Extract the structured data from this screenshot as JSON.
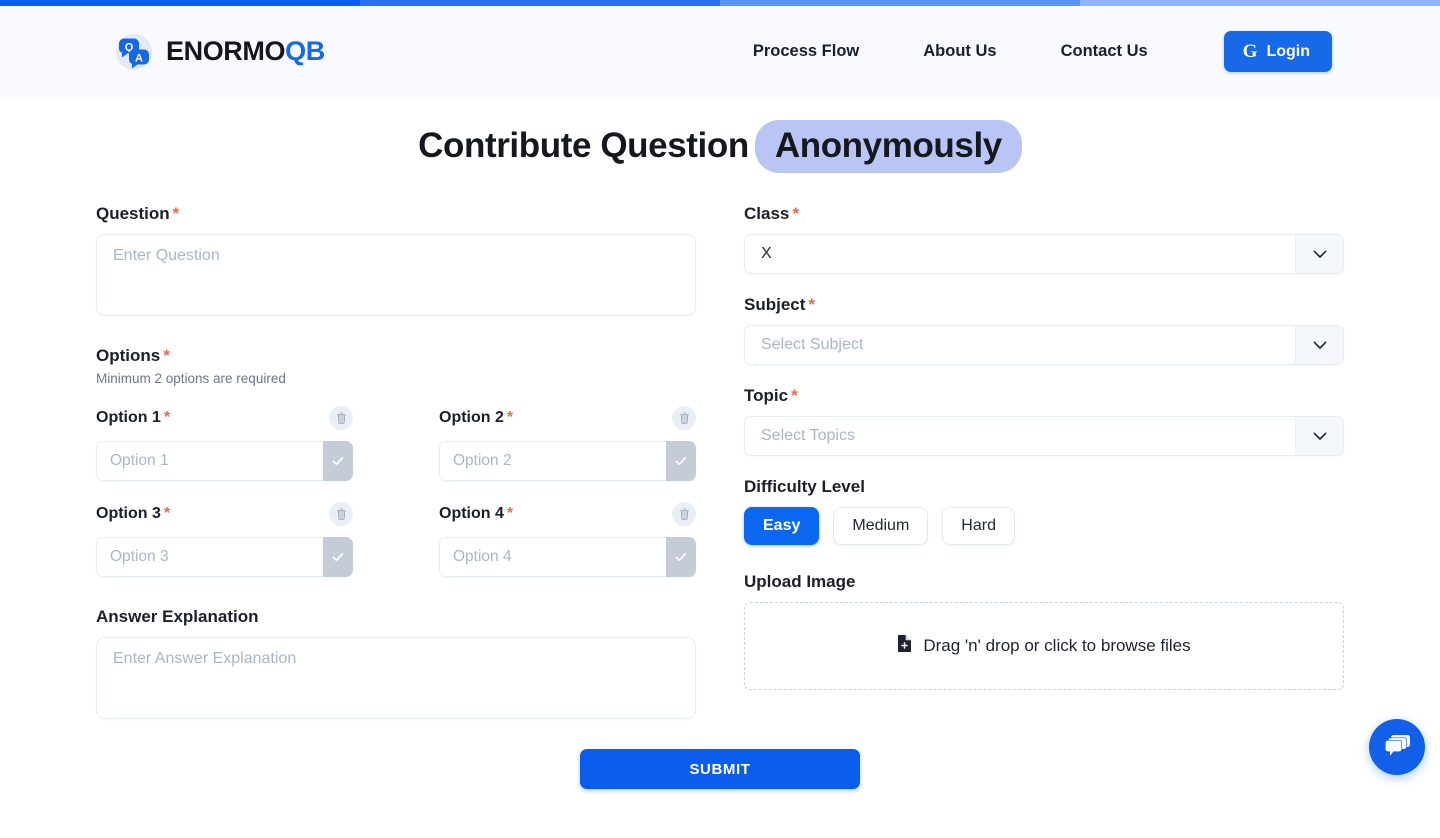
{
  "progress": {
    "segments": [
      "#0b5ded",
      "#2a72ef",
      "#5a93f2",
      "#8cb4f7"
    ]
  },
  "header": {
    "brand": {
      "name_primary": "ENORMO",
      "name_accent": "QB",
      "logo_icon": "qa-speech-bubbles-icon",
      "bubble_q": "Q",
      "bubble_a": "A"
    },
    "nav": [
      {
        "label": "Process Flow"
      },
      {
        "label": "About Us"
      },
      {
        "label": "Contact Us"
      }
    ],
    "login": {
      "label": "Login",
      "icon": "google-g-icon",
      "glyph": "G",
      "color": "#1769e8"
    }
  },
  "page": {
    "title_plain": "Contribute Question",
    "title_highlight": "Anonymously",
    "highlight_color": "#b9c5f4"
  },
  "form": {
    "question": {
      "label": "Question",
      "required_mark": "*",
      "placeholder": "Enter Question",
      "value": ""
    },
    "options_section": {
      "label": "Options",
      "required_mark": "*",
      "note": "Minimum 2 options are required"
    },
    "options": [
      {
        "label": "Option 1",
        "required_mark": "*",
        "placeholder": "Option 1",
        "value": "",
        "delete_icon": "trash-icon",
        "check_icon": "check-icon"
      },
      {
        "label": "Option 2",
        "required_mark": "*",
        "placeholder": "Option 2",
        "value": "",
        "delete_icon": "trash-icon",
        "check_icon": "check-icon"
      },
      {
        "label": "Option 3",
        "required_mark": "*",
        "placeholder": "Option 3",
        "value": "",
        "delete_icon": "trash-icon",
        "check_icon": "check-icon"
      },
      {
        "label": "Option 4",
        "required_mark": "*",
        "placeholder": "Option 4",
        "value": "",
        "delete_icon": "trash-icon",
        "check_icon": "check-icon"
      }
    ],
    "answer_explanation": {
      "label": "Answer Explanation",
      "placeholder": "Enter Answer Explanation",
      "value": ""
    },
    "class": {
      "label": "Class",
      "required_mark": "*",
      "value": "X",
      "caret_icon": "chevron-down-icon"
    },
    "subject": {
      "label": "Subject",
      "required_mark": "*",
      "placeholder": "Select Subject",
      "value": "",
      "caret_icon": "chevron-down-icon"
    },
    "topic": {
      "label": "Topic",
      "required_mark": "*",
      "placeholder": "Select Topics",
      "value": "",
      "caret_icon": "chevron-down-icon"
    },
    "difficulty": {
      "label": "Difficulty Level",
      "selected": "Easy",
      "options": [
        "Easy",
        "Medium",
        "Hard"
      ],
      "active_color": "#0b66f0"
    },
    "upload": {
      "label": "Upload Image",
      "dropzone_text": "Drag 'n' drop or click to browse files",
      "icon": "file-add-icon"
    },
    "submit": {
      "label": "SUBMIT",
      "color": "#0b5ded"
    }
  },
  "chat": {
    "icon": "chat-bubbles-icon",
    "color": "#1360e8"
  }
}
